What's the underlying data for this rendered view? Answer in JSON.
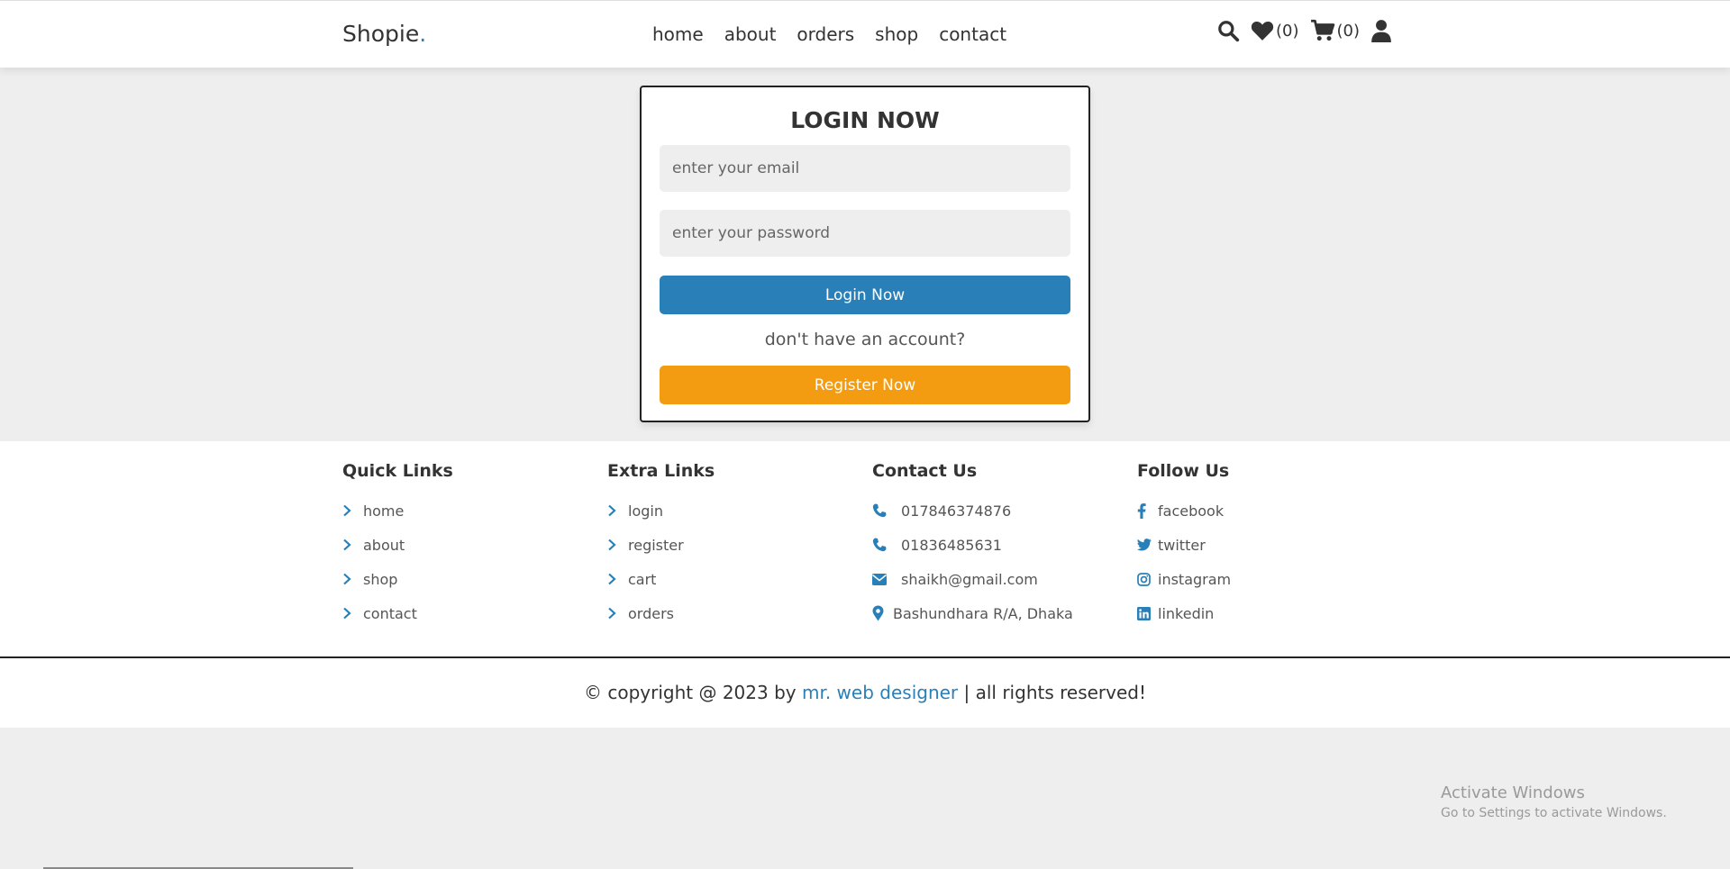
{
  "header": {
    "logo": "Shopie",
    "logo_dot": ".",
    "nav": [
      "home",
      "about",
      "orders",
      "shop",
      "contact"
    ],
    "wishlist_count": "(0)",
    "cart_count": "(0)",
    "icons": [
      "search-icon",
      "heart-icon",
      "cart-icon",
      "user-icon"
    ]
  },
  "login": {
    "title": "LOGIN NOW",
    "email_placeholder": "enter your email",
    "password_placeholder": "enter your password",
    "login_button": "Login Now",
    "no_account": "don't have an account?",
    "register_button": "Register Now"
  },
  "footer": {
    "quick_links": {
      "title": "Quick Links",
      "items": [
        "home",
        "about",
        "shop",
        "contact"
      ]
    },
    "extra_links": {
      "title": "Extra Links",
      "items": [
        "login",
        "register",
        "cart",
        "orders"
      ]
    },
    "contact": {
      "title": "Contact Us",
      "items": [
        "017846374876",
        "01836485631",
        "shaikh@gmail.com",
        "Bashundhara R/A, Dhaka"
      ]
    },
    "follow": {
      "title": "Follow Us",
      "items": [
        "facebook",
        "twitter",
        "instagram",
        "linkedin"
      ]
    },
    "credit_prefix": "© copyright @ 2023 by",
    "credit_author": "mr. web designer",
    "credit_suffix": "| all rights reserved!"
  },
  "watermark": {
    "line1": "Activate Windows",
    "line2": "Go to Settings to activate Windows."
  },
  "colors": {
    "accent": "#2980b9",
    "register": "#f39c12",
    "background": "#eeeeee"
  }
}
